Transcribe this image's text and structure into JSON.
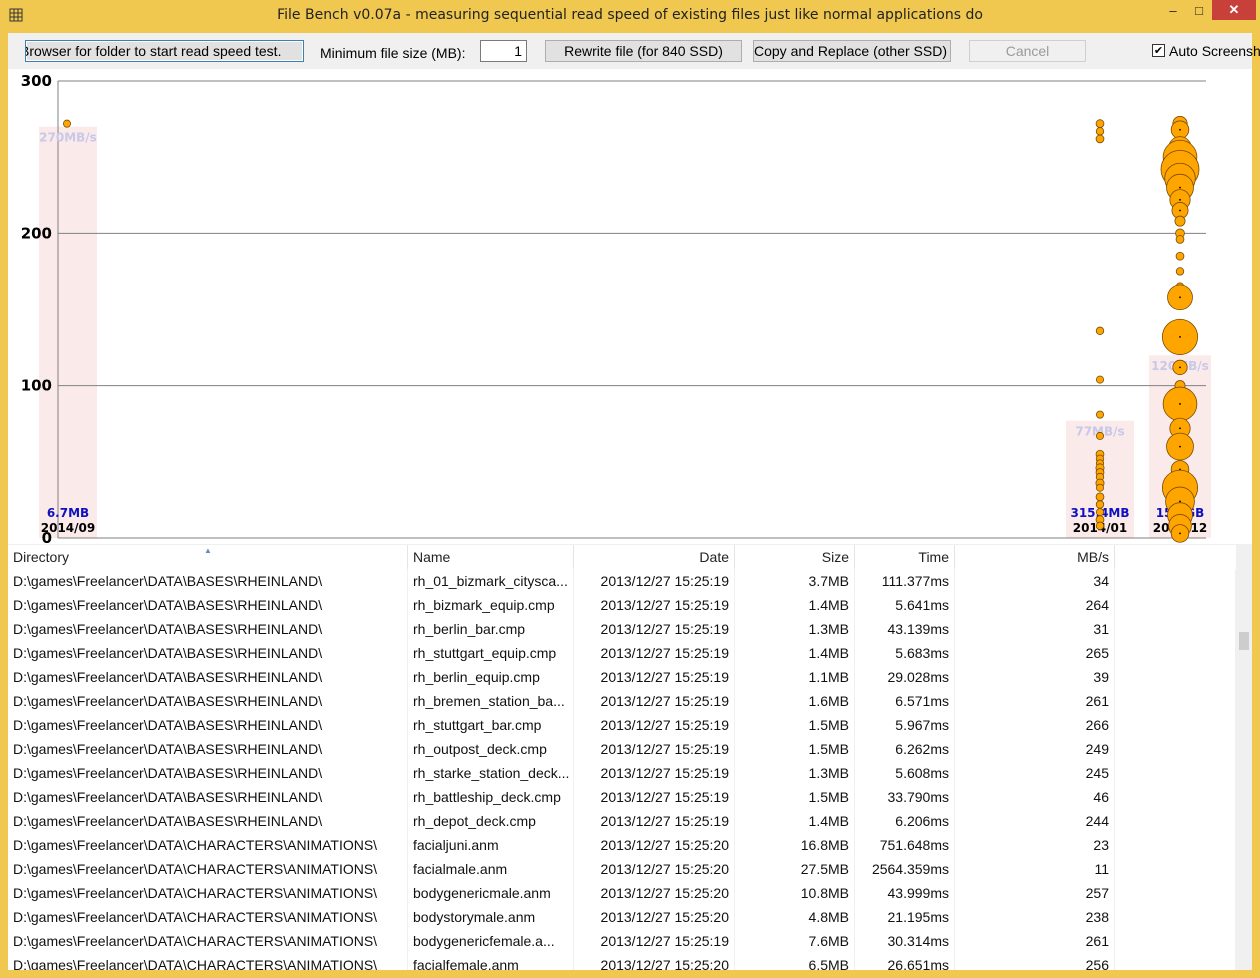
{
  "window": {
    "title": "File Bench v0.07a - measuring sequential read speed of existing files just like normal applications do"
  },
  "titlebar": {
    "minimize": "–",
    "maximize": "□",
    "close": "✕"
  },
  "toolbar": {
    "browse_label": "Browser for folder to start read speed test.",
    "min_size_label": "Minimum file size (MB):",
    "min_size_value": "1",
    "rewrite_label": "Rewrite file (for 840 SSD)",
    "copy_label": "Copy and Replace (other SSD)",
    "cancel_label": "Cancel",
    "auto_label": "Auto Screenshot",
    "auto_checked": true
  },
  "chart_data": {
    "type": "scatter",
    "y_ticks": [
      "300",
      "200",
      "100",
      "0"
    ],
    "ylim": [
      0,
      300
    ],
    "grid": true,
    "groups": [
      {
        "date": "2014/09",
        "size": "6.7MB",
        "avg": "270MB/s",
        "avg_value": 270
      },
      {
        "date": "2014/01",
        "size": "315.4MB",
        "avg": "77MB/s",
        "avg_value": 77
      },
      {
        "date": "2013/12",
        "size": "15.5GB",
        "avg": "120MB/s",
        "avg_value": 120
      }
    ],
    "points": [
      {
        "group": 0,
        "mbs": 272,
        "mb": 1
      },
      {
        "group": 1,
        "mbs": 272,
        "mb": 1.2
      },
      {
        "group": 1,
        "mbs": 267,
        "mb": 1.1
      },
      {
        "group": 1,
        "mbs": 262,
        "mb": 1.2
      },
      {
        "group": 1,
        "mbs": 136,
        "mb": 1.1
      },
      {
        "group": 1,
        "mbs": 104,
        "mb": 1.0
      },
      {
        "group": 1,
        "mbs": 81,
        "mb": 1.0
      },
      {
        "group": 1,
        "mbs": 67,
        "mb": 1.0
      },
      {
        "group": 1,
        "mbs": 55,
        "mb": 1.2
      },
      {
        "group": 1,
        "mbs": 52,
        "mb": 1.1
      },
      {
        "group": 1,
        "mbs": 49,
        "mb": 1.0
      },
      {
        "group": 1,
        "mbs": 46,
        "mb": 1.3
      },
      {
        "group": 1,
        "mbs": 43,
        "mb": 1.2
      },
      {
        "group": 1,
        "mbs": 40,
        "mb": 1.1
      },
      {
        "group": 1,
        "mbs": 36,
        "mb": 1.3
      },
      {
        "group": 1,
        "mbs": 33,
        "mb": 1.0
      },
      {
        "group": 1,
        "mbs": 27,
        "mb": 1.2
      },
      {
        "group": 1,
        "mbs": 22,
        "mb": 1.1
      },
      {
        "group": 1,
        "mbs": 17,
        "mb": 1.0
      },
      {
        "group": 1,
        "mbs": 12,
        "mb": 1.2
      },
      {
        "group": 1,
        "mbs": 8,
        "mb": 1.1
      },
      {
        "group": 2,
        "mbs": 272,
        "mb": 4
      },
      {
        "group": 2,
        "mbs": 268,
        "mb": 6
      },
      {
        "group": 2,
        "mbs": 256,
        "mb": 10
      },
      {
        "group": 2,
        "mbs": 250,
        "mb": 22
      },
      {
        "group": 2,
        "mbs": 242,
        "mb": 28
      },
      {
        "group": 2,
        "mbs": 236,
        "mb": 18
      },
      {
        "group": 2,
        "mbs": 230,
        "mb": 14
      },
      {
        "group": 2,
        "mbs": 222,
        "mb": 8
      },
      {
        "group": 2,
        "mbs": 215,
        "mb": 5
      },
      {
        "group": 2,
        "mbs": 208,
        "mb": 2
      },
      {
        "group": 2,
        "mbs": 200,
        "mb": 1.5
      },
      {
        "group": 2,
        "mbs": 196,
        "mb": 1.2
      },
      {
        "group": 2,
        "mbs": 185,
        "mb": 1.2
      },
      {
        "group": 2,
        "mbs": 175,
        "mb": 1.1
      },
      {
        "group": 2,
        "mbs": 165,
        "mb": 1.1
      },
      {
        "group": 2,
        "mbs": 158,
        "mb": 12
      },
      {
        "group": 2,
        "mbs": 132,
        "mb": 24
      },
      {
        "group": 2,
        "mbs": 112,
        "mb": 4
      },
      {
        "group": 2,
        "mbs": 100,
        "mb": 2
      },
      {
        "group": 2,
        "mbs": 88,
        "mb": 22
      },
      {
        "group": 2,
        "mbs": 72,
        "mb": 8
      },
      {
        "group": 2,
        "mbs": 60,
        "mb": 14
      },
      {
        "group": 2,
        "mbs": 45,
        "mb": 6
      },
      {
        "group": 2,
        "mbs": 33,
        "mb": 24
      },
      {
        "group": 2,
        "mbs": 24,
        "mb": 16
      },
      {
        "group": 2,
        "mbs": 15,
        "mb": 12
      },
      {
        "group": 2,
        "mbs": 8,
        "mb": 10
      },
      {
        "group": 2,
        "mbs": 3,
        "mb": 6
      }
    ]
  },
  "table": {
    "columns": [
      "Directory",
      "Name",
      "Date",
      "Size",
      "Time",
      "MB/s"
    ],
    "rows": [
      {
        "dir": "D:\\games\\Freelancer\\DATA\\BASES\\RHEINLAND\\",
        "name": "rh_01_bizmark_citysca...",
        "date": "2013/12/27 15:25:19",
        "size": "3.7MB",
        "time": "111.377ms",
        "mbs": "34"
      },
      {
        "dir": "D:\\games\\Freelancer\\DATA\\BASES\\RHEINLAND\\",
        "name": "rh_bizmark_equip.cmp",
        "date": "2013/12/27 15:25:19",
        "size": "1.4MB",
        "time": "5.641ms",
        "mbs": "264"
      },
      {
        "dir": "D:\\games\\Freelancer\\DATA\\BASES\\RHEINLAND\\",
        "name": "rh_berlin_bar.cmp",
        "date": "2013/12/27 15:25:19",
        "size": "1.3MB",
        "time": "43.139ms",
        "mbs": "31"
      },
      {
        "dir": "D:\\games\\Freelancer\\DATA\\BASES\\RHEINLAND\\",
        "name": "rh_stuttgart_equip.cmp",
        "date": "2013/12/27 15:25:19",
        "size": "1.4MB",
        "time": "5.683ms",
        "mbs": "265"
      },
      {
        "dir": "D:\\games\\Freelancer\\DATA\\BASES\\RHEINLAND\\",
        "name": "rh_berlin_equip.cmp",
        "date": "2013/12/27 15:25:19",
        "size": "1.1MB",
        "time": "29.028ms",
        "mbs": "39"
      },
      {
        "dir": "D:\\games\\Freelancer\\DATA\\BASES\\RHEINLAND\\",
        "name": "rh_bremen_station_ba...",
        "date": "2013/12/27 15:25:19",
        "size": "1.6MB",
        "time": "6.571ms",
        "mbs": "261"
      },
      {
        "dir": "D:\\games\\Freelancer\\DATA\\BASES\\RHEINLAND\\",
        "name": "rh_stuttgart_bar.cmp",
        "date": "2013/12/27 15:25:19",
        "size": "1.5MB",
        "time": "5.967ms",
        "mbs": "266"
      },
      {
        "dir": "D:\\games\\Freelancer\\DATA\\BASES\\RHEINLAND\\",
        "name": "rh_outpost_deck.cmp",
        "date": "2013/12/27 15:25:19",
        "size": "1.5MB",
        "time": "6.262ms",
        "mbs": "249"
      },
      {
        "dir": "D:\\games\\Freelancer\\DATA\\BASES\\RHEINLAND\\",
        "name": "rh_starke_station_deck...",
        "date": "2013/12/27 15:25:19",
        "size": "1.3MB",
        "time": "5.608ms",
        "mbs": "245"
      },
      {
        "dir": "D:\\games\\Freelancer\\DATA\\BASES\\RHEINLAND\\",
        "name": "rh_battleship_deck.cmp",
        "date": "2013/12/27 15:25:19",
        "size": "1.5MB",
        "time": "33.790ms",
        "mbs": "46"
      },
      {
        "dir": "D:\\games\\Freelancer\\DATA\\BASES\\RHEINLAND\\",
        "name": "rh_depot_deck.cmp",
        "date": "2013/12/27 15:25:19",
        "size": "1.4MB",
        "time": "6.206ms",
        "mbs": "244"
      },
      {
        "dir": "D:\\games\\Freelancer\\DATA\\CHARACTERS\\ANIMATIONS\\",
        "name": "facialjuni.anm",
        "date": "2013/12/27 15:25:20",
        "size": "16.8MB",
        "time": "751.648ms",
        "mbs": "23"
      },
      {
        "dir": "D:\\games\\Freelancer\\DATA\\CHARACTERS\\ANIMATIONS\\",
        "name": "facialmale.anm",
        "date": "2013/12/27 15:25:20",
        "size": "27.5MB",
        "time": "2564.359ms",
        "mbs": "11"
      },
      {
        "dir": "D:\\games\\Freelancer\\DATA\\CHARACTERS\\ANIMATIONS\\",
        "name": "bodygenericmale.anm",
        "date": "2013/12/27 15:25:20",
        "size": "10.8MB",
        "time": "43.999ms",
        "mbs": "257"
      },
      {
        "dir": "D:\\games\\Freelancer\\DATA\\CHARACTERS\\ANIMATIONS\\",
        "name": "bodystorymale.anm",
        "date": "2013/12/27 15:25:20",
        "size": "4.8MB",
        "time": "21.195ms",
        "mbs": "238"
      },
      {
        "dir": "D:\\games\\Freelancer\\DATA\\CHARACTERS\\ANIMATIONS\\",
        "name": "bodygenericfemale.a...",
        "date": "2013/12/27 15:25:19",
        "size": "7.6MB",
        "time": "30.314ms",
        "mbs": "261"
      },
      {
        "dir": "D:\\games\\Freelancer\\DATA\\CHARACTERS\\ANIMATIONS\\",
        "name": "facialfemale.anm",
        "date": "2013/12/27 15:25:20",
        "size": "6.5MB",
        "time": "26.651ms",
        "mbs": "256"
      }
    ]
  },
  "colors": {
    "frame": "#f0c850",
    "point_fill": "#ffa500",
    "point_stroke": "#7a4a00",
    "avg_bar": "#fbeaea",
    "avg_text": "#c8c8e8",
    "size_text": "#1010c0",
    "grid": "#808080"
  }
}
